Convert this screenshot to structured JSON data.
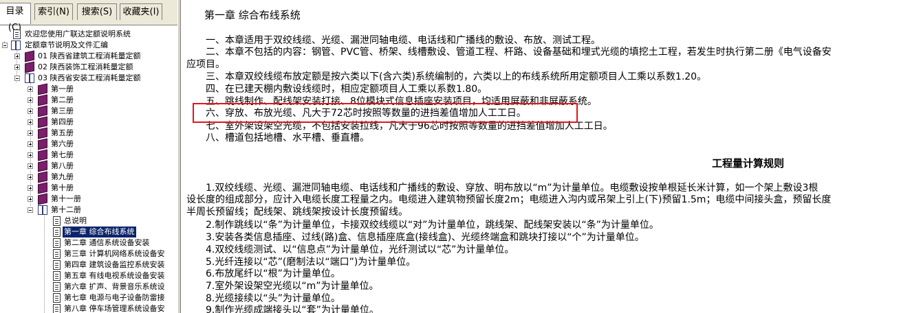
{
  "tabs": [
    {
      "label": "目录(C)"
    },
    {
      "label": "索引(N)"
    },
    {
      "label": "搜索(S)"
    },
    {
      "label": "收藏夹(I)"
    }
  ],
  "tree": [
    {
      "label": "欢迎您使用广联达定额说明系统"
    },
    {
      "label": "定额章节说明及文件汇编"
    },
    {
      "label": "01 陕西省建筑工程消耗量定额"
    },
    {
      "label": "02 陕西装饰工程消耗量定额"
    },
    {
      "label": "03 陕西省安装工程消耗量定额"
    },
    {
      "label": "第一册"
    },
    {
      "label": "第二册"
    },
    {
      "label": "第三册"
    },
    {
      "label": "第四册"
    },
    {
      "label": "第五册"
    },
    {
      "label": "第六册"
    },
    {
      "label": "第七册"
    },
    {
      "label": "第八册"
    },
    {
      "label": "第九册"
    },
    {
      "label": "第十册"
    },
    {
      "label": "第十一册"
    },
    {
      "label": "第十二册"
    },
    {
      "label": "总说明"
    },
    {
      "label": "第一章 综合布线系统"
    },
    {
      "label": "第二章 通信系统设备安装"
    },
    {
      "label": "第三章 计算机网络系统设备安"
    },
    {
      "label": "第四章 建筑设备监控系统安装"
    },
    {
      "label": "第五章 有线电视系统设备安装"
    },
    {
      "label": "第六章 扩声、背景音乐系统设"
    },
    {
      "label": "第七章 电源与电子设备防雷接"
    },
    {
      "label": "第八章 停车场管理系统设备安"
    }
  ],
  "content": {
    "chapter_title": "第一章 综合布线系统",
    "notes": [
      "一、本章适用于双绞线缆、光缆、漏泄同轴电缆、电话线和广播线的敷设、布放、测试工程。",
      "二、本章不包括的内容：钢管、PVC管、桥架、线槽敷设、管道工程、杆路、设备基础和埋式光缆的填挖土工程，若发生时执行第二册《电气设备安",
      "应项目。",
      "三、本章双绞线缆布放定额是按六类以下(含六类)系统编制的，六类以上的布线系统所用定额项目人工乘以系数1.20。",
      "四、在已建天棚内敷设线缆时，相应定额项目人工乘以系数1.80。",
      "五、跳线制作、配线架安装打接、8位模块式信息插座安装项目，均适用屏蔽和非屏蔽系统。",
      "六、穿放、布放光缆、凡大于72芯时按照等数量的进挡差值增加人工工日。",
      "七、室外架设架空光缆，不包括安装拉线，凡大于96芯时按照等数量的进挡差值增加人工工日。",
      "八、槽道包括地槽、水平槽、垂直槽。"
    ],
    "rules_title": "工程量计算规则",
    "rules": [
      "1.双绞线缆、光缆、漏泄同轴电缆、电话线和广播线的敷设、穿放、明布放以“m”为计量单位。电缆敷设按单根延长米计算，如一个架上敷设3根",
      "设长度的组成部分，应计入电缆长度工程量之内。电缆进入建筑物预留长度2m；电缆进入沟内或吊架上引上(下)预留1.5m；电缆中间接头盒，预留长度",
      "半周长预留线；配线架、跳线架按设计长度预留线。",
      "2.制作跳线以“条”为计量单位，卡接双绞线缆以“对”为计量单位，跳线架、配线架安装以“条”为计量单位。",
      "3.安装各类信息插座、过线(路)盒、信息插座底盒(接线盒)、光缆终端盒和跳块打接以“个”为计量单位。",
      "4.双绞线缆测试、以“信息点”为计量单位，光纤测试以“芯”为计量单位。",
      "5.光纤连接以“芯”(磨制法以“端口”)为计量单位。",
      "6.布放尾纤以“根”为计量单位。",
      "7.室外架设架空光缆以“m”为计量单位。",
      "8.光缆接续以“头”为计量单位。",
      "9.制作光缆成端接头以“套”为计量单位。"
    ]
  },
  "colors": {
    "highlight_box": "#e0141e",
    "selection": "#0a246a",
    "book_closed": "#7a1f6a"
  }
}
